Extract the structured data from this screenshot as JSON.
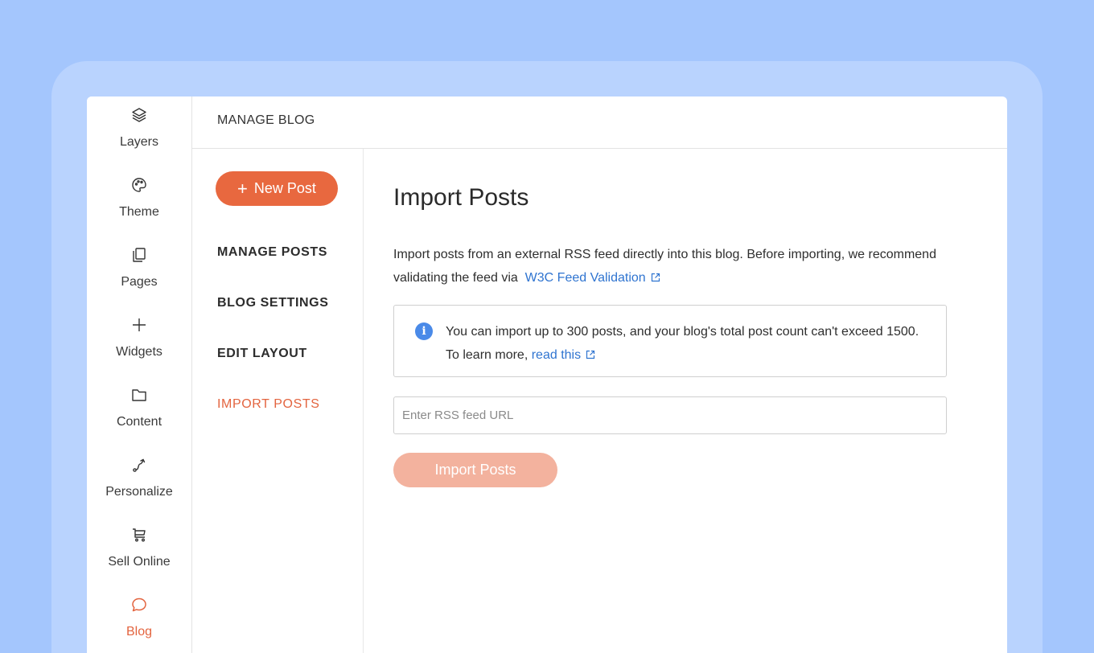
{
  "sidebar": {
    "items": [
      {
        "label": "Layers",
        "icon": "layers-icon"
      },
      {
        "label": "Theme",
        "icon": "palette-icon"
      },
      {
        "label": "Pages",
        "icon": "pages-icon"
      },
      {
        "label": "Widgets",
        "icon": "plus-icon"
      },
      {
        "label": "Content",
        "icon": "folder-icon"
      },
      {
        "label": "Personalize",
        "icon": "route-icon"
      },
      {
        "label": "Sell Online",
        "icon": "cart-icon"
      },
      {
        "label": "Blog",
        "icon": "chat-bubble-icon",
        "active": true
      }
    ]
  },
  "header": {
    "title": "MANAGE BLOG"
  },
  "subnav": {
    "new_post_label": "New Post",
    "items": [
      {
        "label": "MANAGE POSTS"
      },
      {
        "label": "BLOG SETTINGS"
      },
      {
        "label": "EDIT LAYOUT"
      },
      {
        "label": "IMPORT POSTS",
        "active": true
      }
    ]
  },
  "main": {
    "title": "Import Posts",
    "intro_text": "Import posts from an external RSS feed directly into this blog. Before importing, we recommend validating the feed via",
    "intro_link": "W3C Feed Validation",
    "note_text": "You can import up to 300 posts, and your blog's total post count can't exceed 1500. To learn more,",
    "note_link": "read this",
    "rss_placeholder": "Enter RSS feed URL",
    "rss_value": "",
    "import_button": "Import Posts"
  },
  "colors": {
    "accent": "#e8683f",
    "accent_disabled": "#f3b29e",
    "link": "#2f74d0",
    "info": "#4a8ae8",
    "background": "#a4c6fd"
  }
}
